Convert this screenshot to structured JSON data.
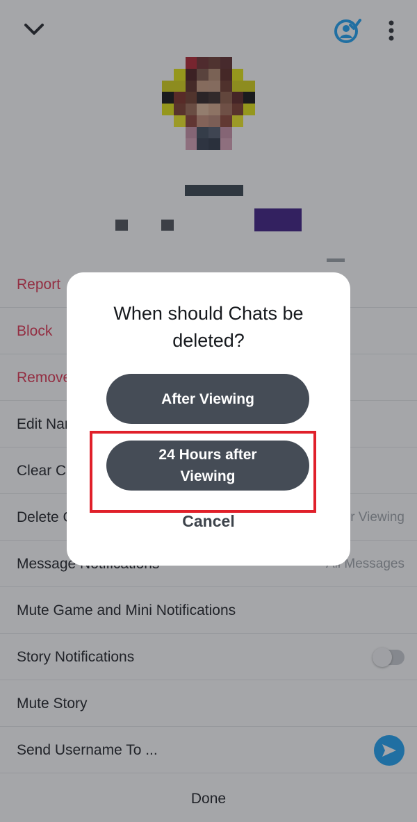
{
  "header": {
    "back_icon": "chevron-down-icon",
    "bitmoji_icon": "snapchat-ghost-check-icon",
    "more_icon": "vertical-ellipsis-icon",
    "accent_color": "#1aa1f3"
  },
  "settings": {
    "items": [
      {
        "label": "Report",
        "value": ""
      },
      {
        "label": "Block",
        "value": ""
      },
      {
        "label": "Remove",
        "value": ""
      },
      {
        "label": "Edit Name",
        "value": ""
      },
      {
        "label": "Clear Conversation",
        "value": ""
      },
      {
        "label": "Delete Chats...",
        "value": "After Viewing"
      },
      {
        "label": "Message Notifications",
        "value": "All Messages"
      },
      {
        "label": "Mute Game and Mini Notifications",
        "value": ""
      },
      {
        "label": "Story Notifications",
        "value": ""
      },
      {
        "label": "Mute Story",
        "value": ""
      },
      {
        "label": "Send Username To ...",
        "value": ""
      }
    ],
    "done_label": "Done",
    "danger_color": "#e0314e"
  },
  "dialog": {
    "title": "When should Chats be deleted?",
    "option_1": "After Viewing",
    "option_2": "24 Hours after Viewing",
    "cancel": "Cancel",
    "highlight_color": "#e0202a"
  }
}
